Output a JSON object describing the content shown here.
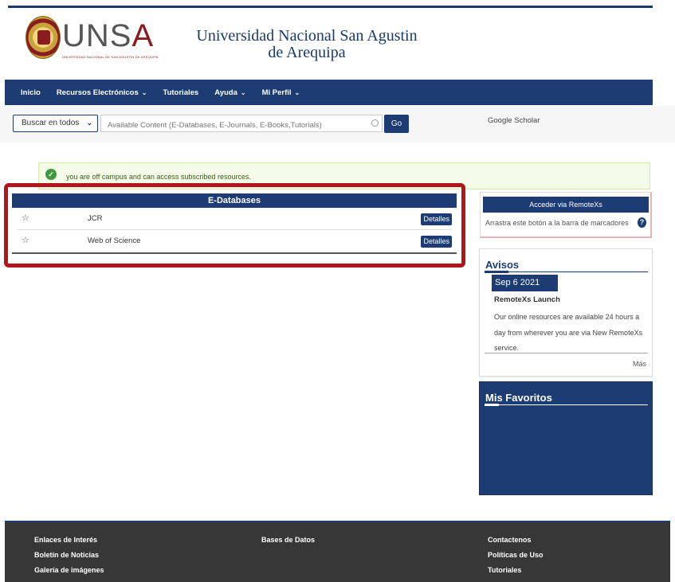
{
  "header": {
    "logo_text_main": "UNS",
    "logo_text_accent": "A",
    "logo_subtext": "UNIVERSIDAD NACIONAL DE SAN AGUSTÍN DE AREQUIPA",
    "title_line1": "Universidad Nacional San Agustin",
    "title_line2": "de Arequipa"
  },
  "nav": {
    "items": [
      {
        "label": "Inicio",
        "dropdown": false
      },
      {
        "label": "Recursos Electrónicos",
        "dropdown": true
      },
      {
        "label": "Tutoriales",
        "dropdown": false
      },
      {
        "label": "Ayuda",
        "dropdown": true
      },
      {
        "label": "Mi Perfil",
        "dropdown": true
      }
    ]
  },
  "search": {
    "scope_selected": "Buscar en todos",
    "placeholder": "Available Content (E-Databases, E-Journals, E-Books,Tutorials)",
    "go_label": "Go",
    "scholar_link": "Google Scholar"
  },
  "alert": {
    "text": "you are off campus and can access subscribed resources."
  },
  "edatabases": {
    "title": "E-Databases",
    "rows": [
      {
        "name": "JCR",
        "button": "Detalles"
      },
      {
        "name": "Web of Science",
        "button": "Detalles"
      }
    ]
  },
  "remotexs": {
    "button": "Acceder via RemoteXs",
    "hint": "Arrastra este botón a la barra de marcadores",
    "help": "?"
  },
  "avisos": {
    "title": "Avisos",
    "date": "Sep 6 2021",
    "news_title": "RemoteXs Launch",
    "news_body": "Our online resources are available 24 hours a day from wherever you are via New RemoteXs service.",
    "more": "Más"
  },
  "favoritos": {
    "title": "Mis Favoritos"
  },
  "footer": {
    "col1": [
      "Enlaces de Interés",
      "Boletín de Noticias",
      "Galería de imágenes"
    ],
    "col2": [
      "Bases de Datos"
    ],
    "col3": [
      "Contactenos",
      "Políticas de Uso",
      "Tutoriales"
    ]
  },
  "colors": {
    "primary": "#1c3c73",
    "accent_red": "#b0161c",
    "footer_bg": "#373737",
    "alert_bg": "#f4fbe8"
  }
}
